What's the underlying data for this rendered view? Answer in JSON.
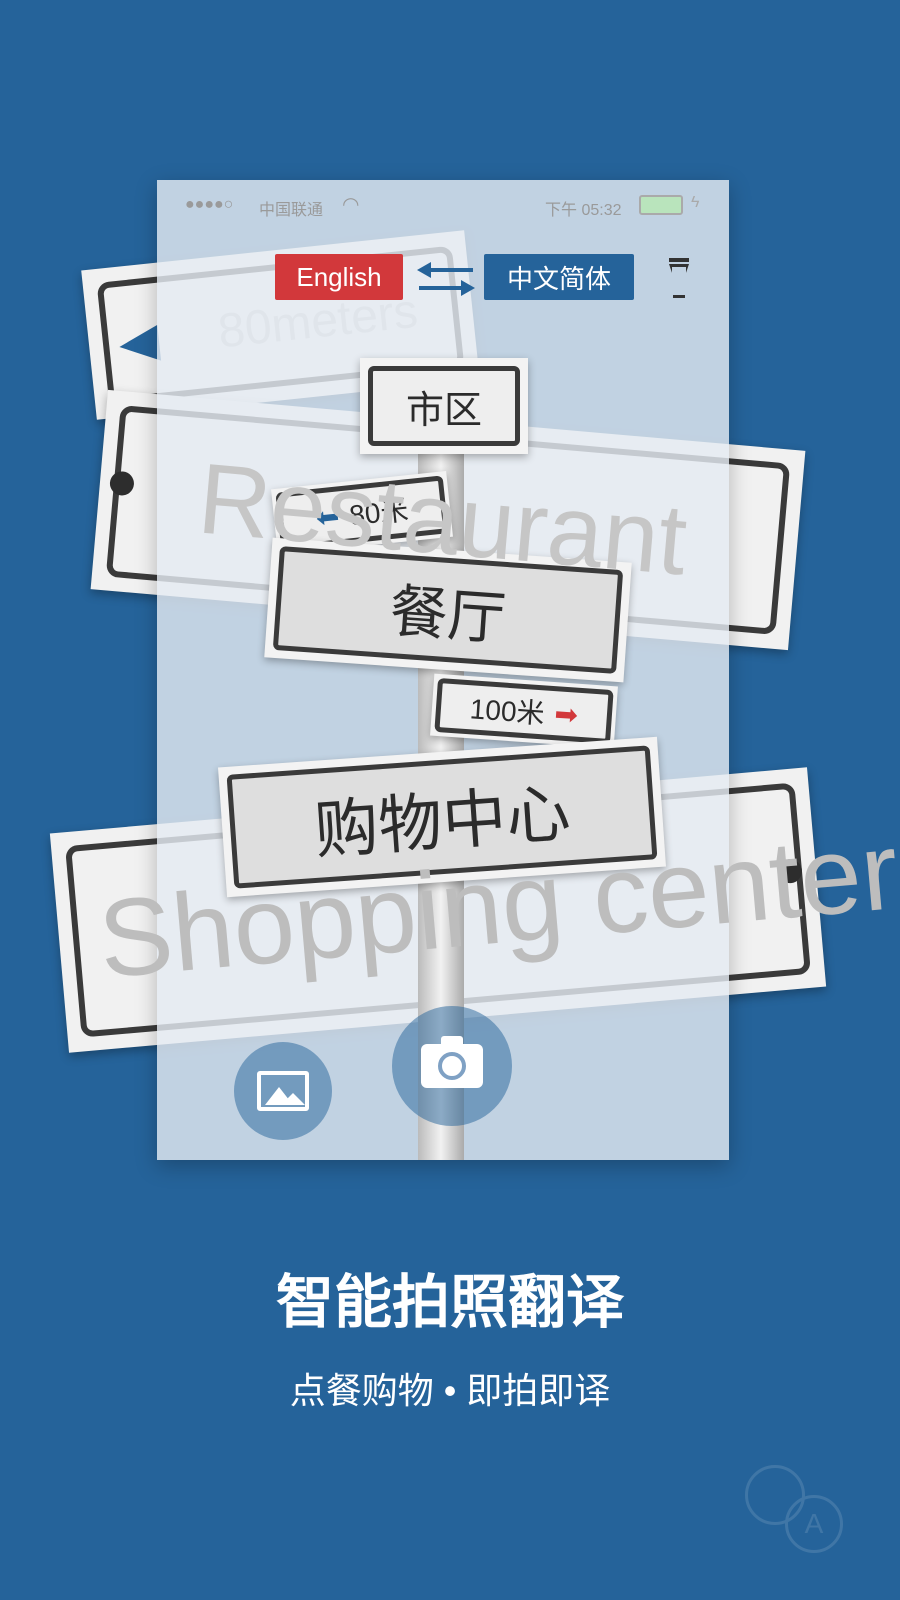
{
  "background_color": "#25639a",
  "accent_red": "#d2383b",
  "accent_blue": "#25639a",
  "status_bar": {
    "signal": "●●●●○",
    "carrier": "中国联通",
    "wifi_icon": "wifi-icon",
    "time": "下午 05:32",
    "battery_icon": "battery-charging-icon"
  },
  "toolbar": {
    "source_lang": "English",
    "swap_icon": "swap-arrows-icon",
    "target_lang": "中文简体",
    "flashlight_icon": "flashlight-icon"
  },
  "scene": {
    "bg_signs": [
      "80meters",
      "Restaurant",
      "Shopping center"
    ],
    "signs": [
      "市区",
      "80米",
      "餐厅",
      "100米",
      "购物中心"
    ]
  },
  "controls": {
    "gallery_icon": "image-icon",
    "camera_icon": "camera-icon"
  },
  "headline": "智能拍照翻译",
  "subheadline": "点餐购物 • 即拍即译",
  "decor_icon": "translate-icon"
}
